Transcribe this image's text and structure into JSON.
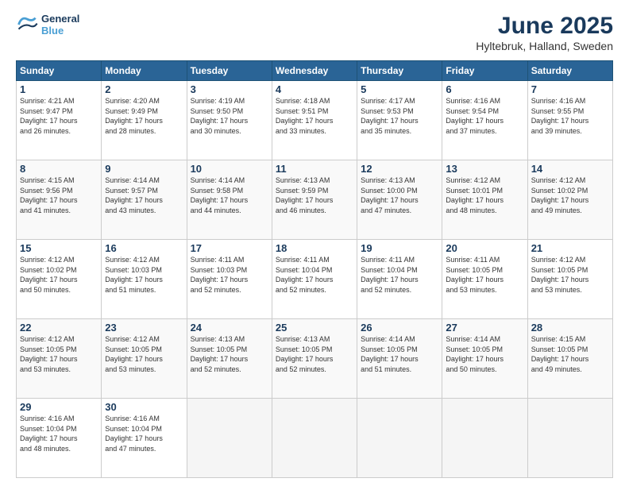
{
  "logo": {
    "line1": "General",
    "line2": "Blue"
  },
  "title": "June 2025",
  "location": "Hyltebruk, Halland, Sweden",
  "days_of_week": [
    "Sunday",
    "Monday",
    "Tuesday",
    "Wednesday",
    "Thursday",
    "Friday",
    "Saturday"
  ],
  "weeks": [
    [
      {
        "day": "1",
        "info": "Sunrise: 4:21 AM\nSunset: 9:47 PM\nDaylight: 17 hours\nand 26 minutes."
      },
      {
        "day": "2",
        "info": "Sunrise: 4:20 AM\nSunset: 9:49 PM\nDaylight: 17 hours\nand 28 minutes."
      },
      {
        "day": "3",
        "info": "Sunrise: 4:19 AM\nSunset: 9:50 PM\nDaylight: 17 hours\nand 30 minutes."
      },
      {
        "day": "4",
        "info": "Sunrise: 4:18 AM\nSunset: 9:51 PM\nDaylight: 17 hours\nand 33 minutes."
      },
      {
        "day": "5",
        "info": "Sunrise: 4:17 AM\nSunset: 9:53 PM\nDaylight: 17 hours\nand 35 minutes."
      },
      {
        "day": "6",
        "info": "Sunrise: 4:16 AM\nSunset: 9:54 PM\nDaylight: 17 hours\nand 37 minutes."
      },
      {
        "day": "7",
        "info": "Sunrise: 4:16 AM\nSunset: 9:55 PM\nDaylight: 17 hours\nand 39 minutes."
      }
    ],
    [
      {
        "day": "8",
        "info": "Sunrise: 4:15 AM\nSunset: 9:56 PM\nDaylight: 17 hours\nand 41 minutes."
      },
      {
        "day": "9",
        "info": "Sunrise: 4:14 AM\nSunset: 9:57 PM\nDaylight: 17 hours\nand 43 minutes."
      },
      {
        "day": "10",
        "info": "Sunrise: 4:14 AM\nSunset: 9:58 PM\nDaylight: 17 hours\nand 44 minutes."
      },
      {
        "day": "11",
        "info": "Sunrise: 4:13 AM\nSunset: 9:59 PM\nDaylight: 17 hours\nand 46 minutes."
      },
      {
        "day": "12",
        "info": "Sunrise: 4:13 AM\nSunset: 10:00 PM\nDaylight: 17 hours\nand 47 minutes."
      },
      {
        "day": "13",
        "info": "Sunrise: 4:12 AM\nSunset: 10:01 PM\nDaylight: 17 hours\nand 48 minutes."
      },
      {
        "day": "14",
        "info": "Sunrise: 4:12 AM\nSunset: 10:02 PM\nDaylight: 17 hours\nand 49 minutes."
      }
    ],
    [
      {
        "day": "15",
        "info": "Sunrise: 4:12 AM\nSunset: 10:02 PM\nDaylight: 17 hours\nand 50 minutes."
      },
      {
        "day": "16",
        "info": "Sunrise: 4:12 AM\nSunset: 10:03 PM\nDaylight: 17 hours\nand 51 minutes."
      },
      {
        "day": "17",
        "info": "Sunrise: 4:11 AM\nSunset: 10:03 PM\nDaylight: 17 hours\nand 52 minutes."
      },
      {
        "day": "18",
        "info": "Sunrise: 4:11 AM\nSunset: 10:04 PM\nDaylight: 17 hours\nand 52 minutes."
      },
      {
        "day": "19",
        "info": "Sunrise: 4:11 AM\nSunset: 10:04 PM\nDaylight: 17 hours\nand 52 minutes."
      },
      {
        "day": "20",
        "info": "Sunrise: 4:11 AM\nSunset: 10:05 PM\nDaylight: 17 hours\nand 53 minutes."
      },
      {
        "day": "21",
        "info": "Sunrise: 4:12 AM\nSunset: 10:05 PM\nDaylight: 17 hours\nand 53 minutes."
      }
    ],
    [
      {
        "day": "22",
        "info": "Sunrise: 4:12 AM\nSunset: 10:05 PM\nDaylight: 17 hours\nand 53 minutes."
      },
      {
        "day": "23",
        "info": "Sunrise: 4:12 AM\nSunset: 10:05 PM\nDaylight: 17 hours\nand 53 minutes."
      },
      {
        "day": "24",
        "info": "Sunrise: 4:13 AM\nSunset: 10:05 PM\nDaylight: 17 hours\nand 52 minutes."
      },
      {
        "day": "25",
        "info": "Sunrise: 4:13 AM\nSunset: 10:05 PM\nDaylight: 17 hours\nand 52 minutes."
      },
      {
        "day": "26",
        "info": "Sunrise: 4:14 AM\nSunset: 10:05 PM\nDaylight: 17 hours\nand 51 minutes."
      },
      {
        "day": "27",
        "info": "Sunrise: 4:14 AM\nSunset: 10:05 PM\nDaylight: 17 hours\nand 50 minutes."
      },
      {
        "day": "28",
        "info": "Sunrise: 4:15 AM\nSunset: 10:05 PM\nDaylight: 17 hours\nand 49 minutes."
      }
    ],
    [
      {
        "day": "29",
        "info": "Sunrise: 4:16 AM\nSunset: 10:04 PM\nDaylight: 17 hours\nand 48 minutes."
      },
      {
        "day": "30",
        "info": "Sunrise: 4:16 AM\nSunset: 10:04 PM\nDaylight: 17 hours\nand 47 minutes."
      },
      {
        "day": "",
        "info": ""
      },
      {
        "day": "",
        "info": ""
      },
      {
        "day": "",
        "info": ""
      },
      {
        "day": "",
        "info": ""
      },
      {
        "day": "",
        "info": ""
      }
    ]
  ]
}
